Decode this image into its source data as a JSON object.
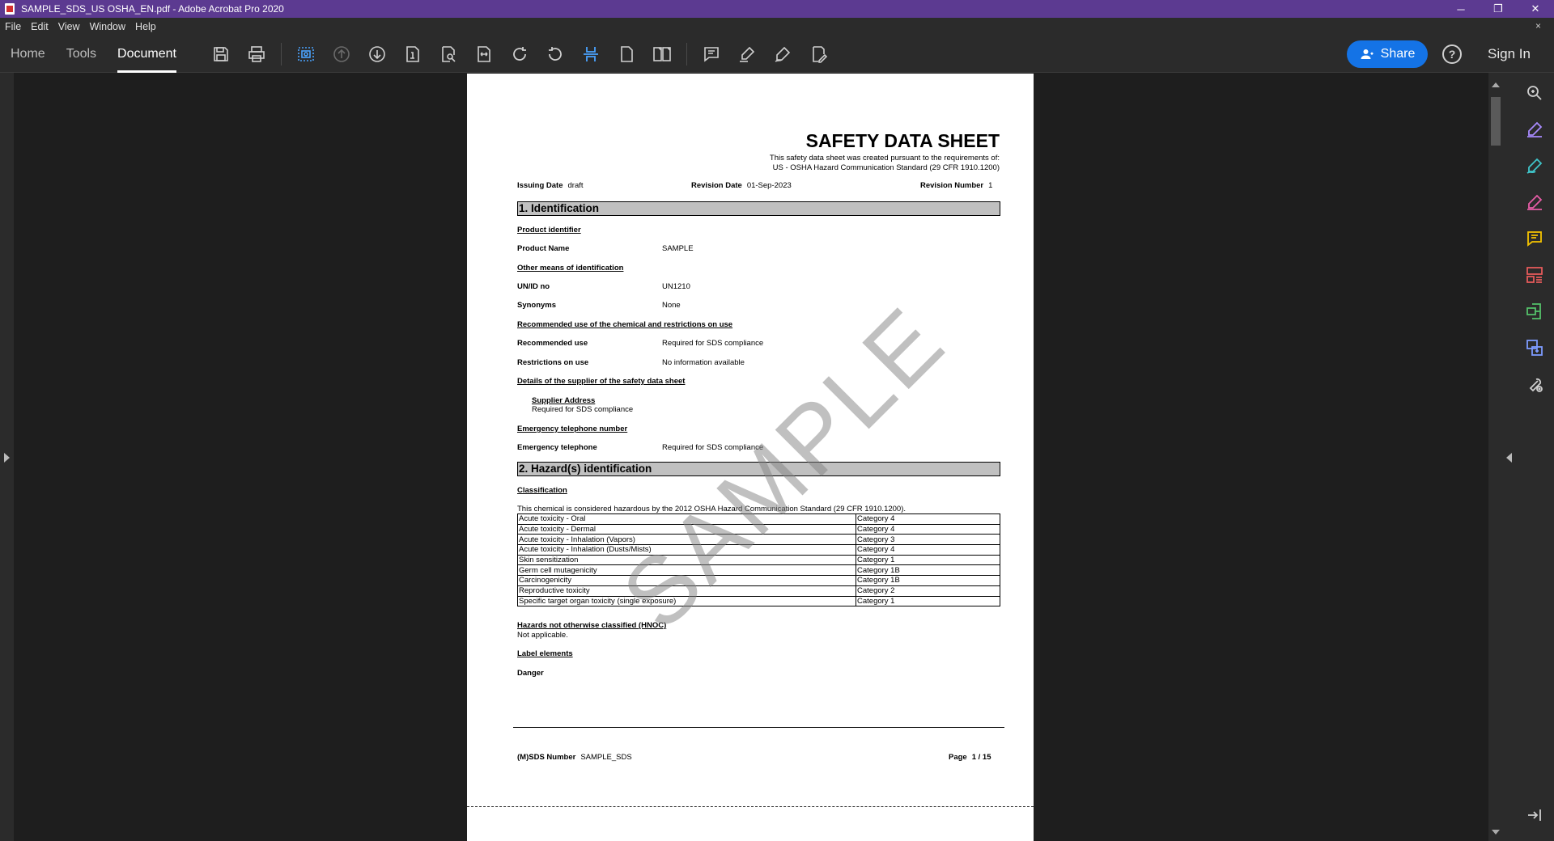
{
  "window": {
    "title": "SAMPLE_SDS_US OSHA_EN.pdf - Adobe Acrobat Pro 2020",
    "controls": {
      "minimize": "─",
      "restore": "❐",
      "close": "✕"
    }
  },
  "menubar": {
    "items": [
      "File",
      "Edit",
      "View",
      "Window",
      "Help"
    ],
    "close_doc": "×"
  },
  "toolbar": {
    "tabs": [
      "Home",
      "Tools",
      "Document"
    ],
    "active_tab": "Document",
    "share_label": "Share",
    "help_label": "?",
    "signin_label": "Sign In",
    "accent": "#1473e6"
  },
  "document": {
    "title": "SAFETY DATA SHEET",
    "subtitle_line1": "This safety data sheet was created pursuant to the requirements of:",
    "subtitle_line2": "US - OSHA Hazard Communication Standard (29 CFR 1910.1200)",
    "issuing_date_label": "Issuing Date",
    "issuing_date_value": "draft",
    "revision_date_label": "Revision Date",
    "revision_date_value": "01-Sep-2023",
    "revision_number_label": "Revision Number",
    "revision_number_value": "1",
    "section1_title": "1. Identification",
    "product_identifier": "Product identifier",
    "product_name_label": "Product Name",
    "product_name_value": "SAMPLE",
    "other_means": "Other means of identification",
    "unid_label": "UN/ID no",
    "unid_value": "UN1210",
    "synonyms_label": "Synonyms",
    "synonyms_value": "None",
    "recommended_heading": "Recommended use of the chemical and restrictions on use",
    "recommended_use_label": "Recommended use",
    "recommended_use_value": "Required for SDS compliance",
    "restrictions_label": "Restrictions on use",
    "restrictions_value": "No information available",
    "supplier_heading": "Details of the supplier of the safety data sheet",
    "supplier_address_label": "Supplier Address",
    "supplier_address_value": "Required for SDS compliance",
    "emergency_heading": "Emergency telephone number",
    "emergency_label": "Emergency telephone",
    "emergency_value": "Required for SDS compliance",
    "section2_title": "2. Hazard(s) identification",
    "classification_heading": "Classification",
    "classification_text": "This chemical is considered hazardous by the 2012 OSHA Hazard Communication Standard (29 CFR 1910.1200).",
    "hazards": [
      {
        "name": "Acute toxicity - Oral",
        "category": "Category 4"
      },
      {
        "name": "Acute toxicity - Dermal",
        "category": "Category 4"
      },
      {
        "name": "Acute toxicity - Inhalation (Vapors)",
        "category": "Category 3"
      },
      {
        "name": "Acute toxicity - Inhalation (Dusts/Mists)",
        "category": "Category 4"
      },
      {
        "name": "Skin sensitization",
        "category": "Category 1"
      },
      {
        "name": "Germ cell mutagenicity",
        "category": "Category 1B"
      },
      {
        "name": "Carcinogenicity",
        "category": "Category 1B"
      },
      {
        "name": "Reproductive toxicity",
        "category": "Category 2"
      },
      {
        "name": "Specific target organ toxicity (single exposure)",
        "category": "Category 1"
      }
    ],
    "hnoc_heading": "Hazards not otherwise classified (HNOC)",
    "hnoc_value": "Not applicable.",
    "label_elements_heading": "Label elements",
    "signal_word": "Danger",
    "footer_sds_label": "(M)SDS Number",
    "footer_sds_value": "SAMPLE_SDS",
    "footer_page_label": "Page",
    "footer_page_value": "1 / 15",
    "watermark": "SAMPLE"
  }
}
